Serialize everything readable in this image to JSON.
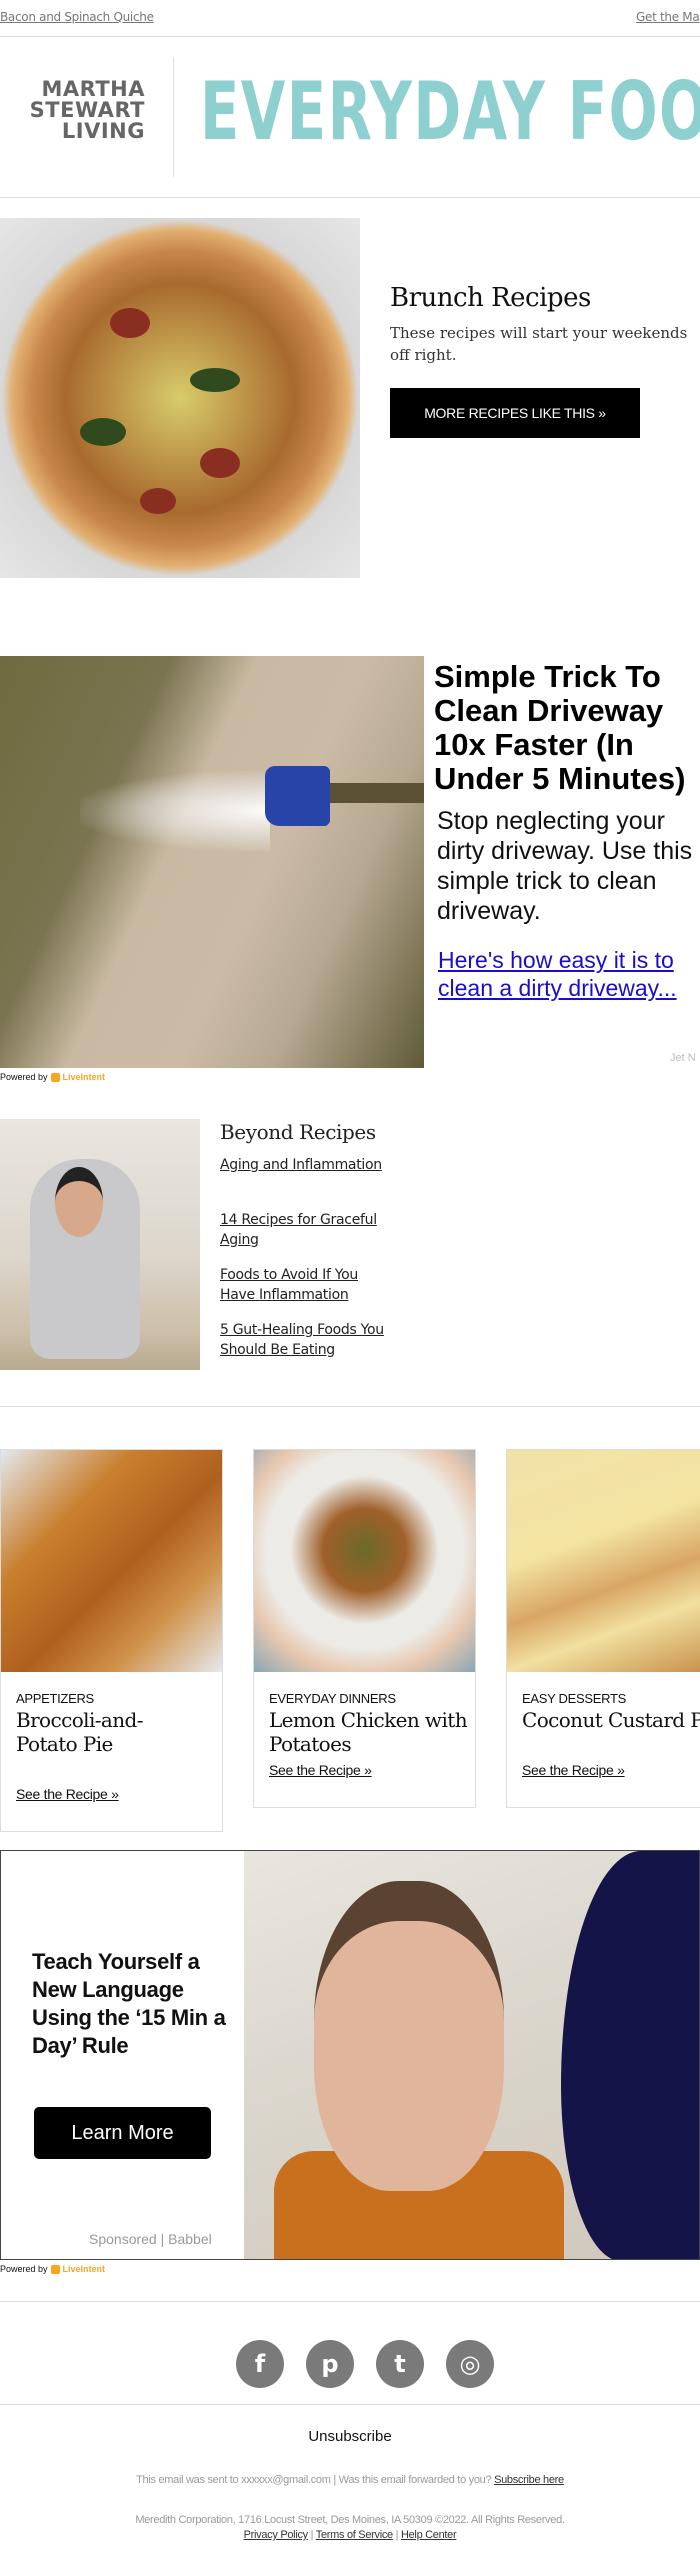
{
  "topbar": {
    "left_link": "Bacon and Spinach Quiche",
    "right_link": "Get the Mag"
  },
  "header": {
    "brand_line1": "MARTHA",
    "brand_line2": "STEWART",
    "brand_line3": "LIVING",
    "title": "EVERYDAY FOOD"
  },
  "hero": {
    "title": "Brunch Recipes",
    "description": "These recipes will start your weekends off right.",
    "button_label": "MORE RECIPES LIKE THIS »"
  },
  "ad_driveway": {
    "title": "Simple Trick To Clean Driveway 10x Faster (In Under 5 Minutes)",
    "description": "Stop neglecting your dirty driveway. Use this simple trick to clean driveway.",
    "link": "Here's how easy it is to clean a dirty driveway...",
    "sponsor": "Jet N",
    "powered_by": "Powered by",
    "powered_brand": "LiveIntent"
  },
  "beyond": {
    "title": "Beyond Recipes",
    "links": [
      "Aging and Inflammation",
      "14 Recipes for Graceful Aging",
      "Foods to Avoid If You Have Inflammation",
      "5 Gut-Healing Foods You Should Be Eating"
    ]
  },
  "cards": [
    {
      "category": "APPETIZERS",
      "title": "Broccoli-and-Potato Pie",
      "link": "See the Recipe »"
    },
    {
      "category": "EVERYDAY DINNERS",
      "title": "Lemon Chicken with Potatoes",
      "link": "See the Recipe »"
    },
    {
      "category": "EASY DESSERTS",
      "title": "Coconut Custard Pie",
      "link": "See the Recipe »"
    }
  ],
  "ad_babbel": {
    "title": "Teach Yourself a New Language Using the ‘15 Min a Day’ Rule",
    "button_label": "Learn More",
    "sponsor": "Sponsored | Babbel",
    "powered_by": "Powered by",
    "powered_brand": "LiveIntent"
  },
  "social": {
    "facebook": "f",
    "pinterest": "p",
    "twitter": "t",
    "instagram": "◎"
  },
  "footer": {
    "unsubscribe": "Unsubscribe",
    "sent_to": "This email was sent to xxxxxx@gmail.com  |  Was this email forwarded to you?",
    "subscribe_link": "Subscribe here",
    "address": "Meredith Corporation, 1716 Locust Street, Des Moines, IA 50309 ©2022. All Rights Reserved.",
    "privacy": "Privacy Policy",
    "terms": "Terms of Service",
    "help": "Help Center",
    "separator": "|"
  }
}
